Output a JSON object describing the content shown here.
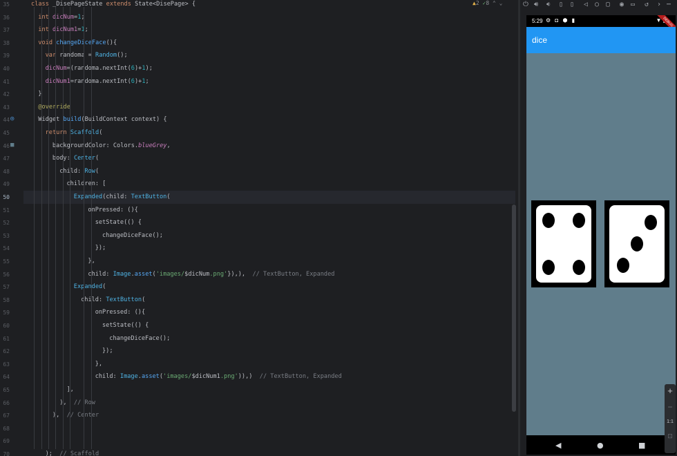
{
  "inspections": {
    "warnings": "2",
    "ok": "8"
  },
  "editor": {
    "lines": [
      {
        "n": "35",
        "indent": 0,
        "parts": [
          [
            "kw",
            "class "
          ],
          [
            "pl",
            "_DisePageState "
          ],
          [
            "kw",
            "extends "
          ],
          [
            "pl",
            "State<DisePage> {"
          ]
        ]
      },
      {
        "n": "36",
        "indent": 1,
        "parts": [
          [
            "kw",
            "int "
          ],
          [
            "fld",
            "dicNum"
          ],
          [
            "pl",
            "="
          ],
          [
            "num",
            "1"
          ],
          [
            "pl",
            ";"
          ]
        ]
      },
      {
        "n": "37",
        "indent": 1,
        "parts": [
          [
            "kw",
            "int "
          ],
          [
            "fld",
            "dicNum1"
          ],
          [
            "pl",
            "="
          ],
          [
            "num",
            "1"
          ],
          [
            "pl",
            ";"
          ]
        ]
      },
      {
        "n": "38",
        "indent": 1,
        "parts": [
          [
            "kw",
            "void "
          ],
          [
            "fn",
            "changeDiceFace"
          ],
          [
            "pl",
            "(){"
          ]
        ]
      },
      {
        "n": "39",
        "indent": 2,
        "parts": [
          [
            "kw",
            "var "
          ],
          [
            "pl",
            "randoma = "
          ],
          [
            "ty",
            "Random"
          ],
          [
            "pl",
            "();"
          ]
        ]
      },
      {
        "n": "40",
        "indent": 2,
        "parts": [
          [
            "fld",
            "dicNum"
          ],
          [
            "pl",
            "=(randoma.nextInt("
          ],
          [
            "num",
            "6"
          ],
          [
            "pl",
            ")+"
          ],
          [
            "num",
            "1"
          ],
          [
            "pl",
            ");"
          ]
        ]
      },
      {
        "n": "41",
        "indent": 2,
        "parts": [
          [
            "fld",
            "dicNum1"
          ],
          [
            "pl",
            "=randoma.nextInt("
          ],
          [
            "num",
            "6"
          ],
          [
            "pl",
            ")+"
          ],
          [
            "num",
            "1"
          ],
          [
            "pl",
            ";"
          ]
        ]
      },
      {
        "n": "42",
        "indent": 1,
        "parts": [
          [
            "pl",
            "}"
          ]
        ]
      },
      {
        "n": "43",
        "indent": 1,
        "parts": [
          [
            "anno",
            "@override"
          ]
        ]
      },
      {
        "n": "44",
        "indent": 1,
        "parts": [
          [
            "pl",
            "Widget "
          ],
          [
            "fn",
            "build"
          ],
          [
            "pl",
            "(BuildContext context) {"
          ]
        ]
      },
      {
        "n": "45",
        "indent": 2,
        "parts": [
          [
            "kw",
            "return "
          ],
          [
            "ty",
            "Scaffold"
          ],
          [
            "pl",
            "("
          ]
        ]
      },
      {
        "n": "46",
        "indent": 3,
        "parts": [
          [
            "pl",
            "backgroundColor: Colors."
          ],
          [
            "it",
            "blueGrey"
          ],
          [
            "pl",
            ","
          ]
        ]
      },
      {
        "n": "47",
        "indent": 3,
        "parts": [
          [
            "pl",
            "body: "
          ],
          [
            "ty",
            "Center"
          ],
          [
            "pl",
            "("
          ]
        ]
      },
      {
        "n": "48",
        "indent": 4,
        "parts": [
          [
            "pl",
            "child: "
          ],
          [
            "ty",
            "Row"
          ],
          [
            "pl",
            "("
          ]
        ]
      },
      {
        "n": "49",
        "indent": 5,
        "parts": [
          [
            "pl",
            "children: ["
          ]
        ]
      },
      {
        "n": "50",
        "indent": 6,
        "parts": [
          [
            "ty",
            "Expanded"
          ],
          [
            "pl",
            "(child: "
          ],
          [
            "ty",
            "TextButton"
          ],
          [
            "pl",
            "("
          ]
        ]
      },
      {
        "n": "51",
        "indent": 8,
        "parts": [
          [
            "pl",
            "onPressed: (){"
          ]
        ]
      },
      {
        "n": "52",
        "indent": 9,
        "parts": [
          [
            "pl",
            "setState(() {"
          ]
        ]
      },
      {
        "n": "53",
        "indent": 10,
        "parts": [
          [
            "pl",
            "changeDiceFace();"
          ]
        ]
      },
      {
        "n": "54",
        "indent": 9,
        "parts": [
          [
            "pl",
            "});"
          ]
        ]
      },
      {
        "n": "55",
        "indent": 8,
        "parts": [
          [
            "pl",
            "},"
          ]
        ]
      },
      {
        "n": "56",
        "indent": 8,
        "parts": [
          [
            "pl",
            "child: "
          ],
          [
            "ty",
            "Image"
          ],
          [
            "pl",
            "."
          ],
          [
            "fn",
            "asset"
          ],
          [
            "pl",
            "("
          ],
          [
            "str",
            "'images/"
          ],
          [
            "pl",
            "$dicNum"
          ],
          [
            "str",
            ".png'"
          ],
          [
            "pl",
            "}),),  "
          ],
          [
            "cm",
            "// TextButton, Expanded"
          ]
        ]
      },
      {
        "n": "57",
        "indent": 6,
        "parts": [
          [
            "ty",
            "Expanded"
          ],
          [
            "pl",
            "("
          ]
        ]
      },
      {
        "n": "58",
        "indent": 7,
        "parts": [
          [
            "pl",
            "child: "
          ],
          [
            "ty",
            "TextButton"
          ],
          [
            "pl",
            "("
          ]
        ]
      },
      {
        "n": "59",
        "indent": 9,
        "parts": [
          [
            "pl",
            "onPressed: (){"
          ]
        ]
      },
      {
        "n": "60",
        "indent": 10,
        "parts": [
          [
            "pl",
            "setState(() {"
          ]
        ]
      },
      {
        "n": "61",
        "indent": 11,
        "parts": [
          [
            "pl",
            "changeDiceFace();"
          ]
        ]
      },
      {
        "n": "62",
        "indent": 10,
        "parts": [
          [
            "pl",
            "});"
          ]
        ]
      },
      {
        "n": "63",
        "indent": 9,
        "parts": [
          [
            "pl",
            "},"
          ]
        ]
      },
      {
        "n": "64",
        "indent": 9,
        "parts": [
          [
            "pl",
            "child: "
          ],
          [
            "ty",
            "Image"
          ],
          [
            "pl",
            "."
          ],
          [
            "fn",
            "asset"
          ],
          [
            "pl",
            "("
          ],
          [
            "str",
            "'images/"
          ],
          [
            "pl",
            "$dicNum1"
          ],
          [
            "str",
            ".png'"
          ],
          [
            "pl",
            ")),)  "
          ],
          [
            "cm",
            "// TextButton, Expanded"
          ]
        ]
      },
      {
        "n": "65",
        "indent": 5,
        "parts": [
          [
            "pl",
            "],"
          ]
        ]
      },
      {
        "n": "66",
        "indent": 4,
        "parts": [
          [
            "pl",
            "),  "
          ],
          [
            "cm",
            "// Row"
          ]
        ]
      },
      {
        "n": "67",
        "indent": 3,
        "parts": [
          [
            "pl",
            "),  "
          ],
          [
            "cm",
            "// Center"
          ]
        ]
      },
      {
        "n": "68",
        "indent": 0,
        "parts": []
      },
      {
        "n": "69",
        "indent": 0,
        "parts": []
      },
      {
        "n": "70",
        "indent": 2,
        "parts": [
          [
            "pl",
            ");  "
          ],
          [
            "cm",
            "// Scaffold"
          ]
        ]
      }
    ]
  },
  "phone": {
    "time": "5:29",
    "app_title": "dice",
    "debug_banner": "DEBUG",
    "left_die_value": 4,
    "right_die_value": 3
  },
  "zoom": {
    "plus": "+",
    "minus": "−",
    "ratio": "1:1"
  }
}
